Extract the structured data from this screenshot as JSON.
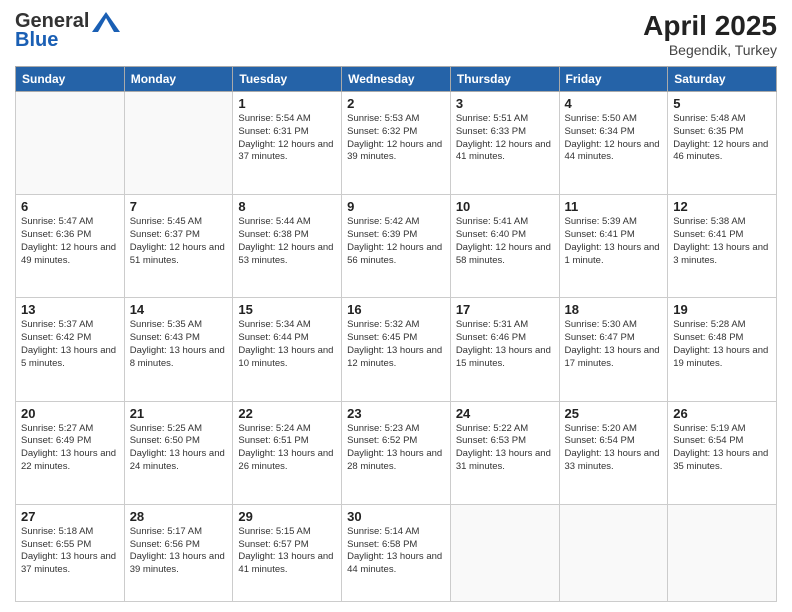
{
  "header": {
    "logo_general": "General",
    "logo_blue": "Blue",
    "month_title": "April 2025",
    "subtitle": "Begendik, Turkey"
  },
  "days_of_week": [
    "Sunday",
    "Monday",
    "Tuesday",
    "Wednesday",
    "Thursday",
    "Friday",
    "Saturday"
  ],
  "weeks": [
    [
      {
        "day": "",
        "info": ""
      },
      {
        "day": "",
        "info": ""
      },
      {
        "day": "1",
        "info": "Sunrise: 5:54 AM\nSunset: 6:31 PM\nDaylight: 12 hours and 37 minutes."
      },
      {
        "day": "2",
        "info": "Sunrise: 5:53 AM\nSunset: 6:32 PM\nDaylight: 12 hours and 39 minutes."
      },
      {
        "day": "3",
        "info": "Sunrise: 5:51 AM\nSunset: 6:33 PM\nDaylight: 12 hours and 41 minutes."
      },
      {
        "day": "4",
        "info": "Sunrise: 5:50 AM\nSunset: 6:34 PM\nDaylight: 12 hours and 44 minutes."
      },
      {
        "day": "5",
        "info": "Sunrise: 5:48 AM\nSunset: 6:35 PM\nDaylight: 12 hours and 46 minutes."
      }
    ],
    [
      {
        "day": "6",
        "info": "Sunrise: 5:47 AM\nSunset: 6:36 PM\nDaylight: 12 hours and 49 minutes."
      },
      {
        "day": "7",
        "info": "Sunrise: 5:45 AM\nSunset: 6:37 PM\nDaylight: 12 hours and 51 minutes."
      },
      {
        "day": "8",
        "info": "Sunrise: 5:44 AM\nSunset: 6:38 PM\nDaylight: 12 hours and 53 minutes."
      },
      {
        "day": "9",
        "info": "Sunrise: 5:42 AM\nSunset: 6:39 PM\nDaylight: 12 hours and 56 minutes."
      },
      {
        "day": "10",
        "info": "Sunrise: 5:41 AM\nSunset: 6:40 PM\nDaylight: 12 hours and 58 minutes."
      },
      {
        "day": "11",
        "info": "Sunrise: 5:39 AM\nSunset: 6:41 PM\nDaylight: 13 hours and 1 minute."
      },
      {
        "day": "12",
        "info": "Sunrise: 5:38 AM\nSunset: 6:41 PM\nDaylight: 13 hours and 3 minutes."
      }
    ],
    [
      {
        "day": "13",
        "info": "Sunrise: 5:37 AM\nSunset: 6:42 PM\nDaylight: 13 hours and 5 minutes."
      },
      {
        "day": "14",
        "info": "Sunrise: 5:35 AM\nSunset: 6:43 PM\nDaylight: 13 hours and 8 minutes."
      },
      {
        "day": "15",
        "info": "Sunrise: 5:34 AM\nSunset: 6:44 PM\nDaylight: 13 hours and 10 minutes."
      },
      {
        "day": "16",
        "info": "Sunrise: 5:32 AM\nSunset: 6:45 PM\nDaylight: 13 hours and 12 minutes."
      },
      {
        "day": "17",
        "info": "Sunrise: 5:31 AM\nSunset: 6:46 PM\nDaylight: 13 hours and 15 minutes."
      },
      {
        "day": "18",
        "info": "Sunrise: 5:30 AM\nSunset: 6:47 PM\nDaylight: 13 hours and 17 minutes."
      },
      {
        "day": "19",
        "info": "Sunrise: 5:28 AM\nSunset: 6:48 PM\nDaylight: 13 hours and 19 minutes."
      }
    ],
    [
      {
        "day": "20",
        "info": "Sunrise: 5:27 AM\nSunset: 6:49 PM\nDaylight: 13 hours and 22 minutes."
      },
      {
        "day": "21",
        "info": "Sunrise: 5:25 AM\nSunset: 6:50 PM\nDaylight: 13 hours and 24 minutes."
      },
      {
        "day": "22",
        "info": "Sunrise: 5:24 AM\nSunset: 6:51 PM\nDaylight: 13 hours and 26 minutes."
      },
      {
        "day": "23",
        "info": "Sunrise: 5:23 AM\nSunset: 6:52 PM\nDaylight: 13 hours and 28 minutes."
      },
      {
        "day": "24",
        "info": "Sunrise: 5:22 AM\nSunset: 6:53 PM\nDaylight: 13 hours and 31 minutes."
      },
      {
        "day": "25",
        "info": "Sunrise: 5:20 AM\nSunset: 6:54 PM\nDaylight: 13 hours and 33 minutes."
      },
      {
        "day": "26",
        "info": "Sunrise: 5:19 AM\nSunset: 6:54 PM\nDaylight: 13 hours and 35 minutes."
      }
    ],
    [
      {
        "day": "27",
        "info": "Sunrise: 5:18 AM\nSunset: 6:55 PM\nDaylight: 13 hours and 37 minutes."
      },
      {
        "day": "28",
        "info": "Sunrise: 5:17 AM\nSunset: 6:56 PM\nDaylight: 13 hours and 39 minutes."
      },
      {
        "day": "29",
        "info": "Sunrise: 5:15 AM\nSunset: 6:57 PM\nDaylight: 13 hours and 41 minutes."
      },
      {
        "day": "30",
        "info": "Sunrise: 5:14 AM\nSunset: 6:58 PM\nDaylight: 13 hours and 44 minutes."
      },
      {
        "day": "",
        "info": ""
      },
      {
        "day": "",
        "info": ""
      },
      {
        "day": "",
        "info": ""
      }
    ]
  ]
}
